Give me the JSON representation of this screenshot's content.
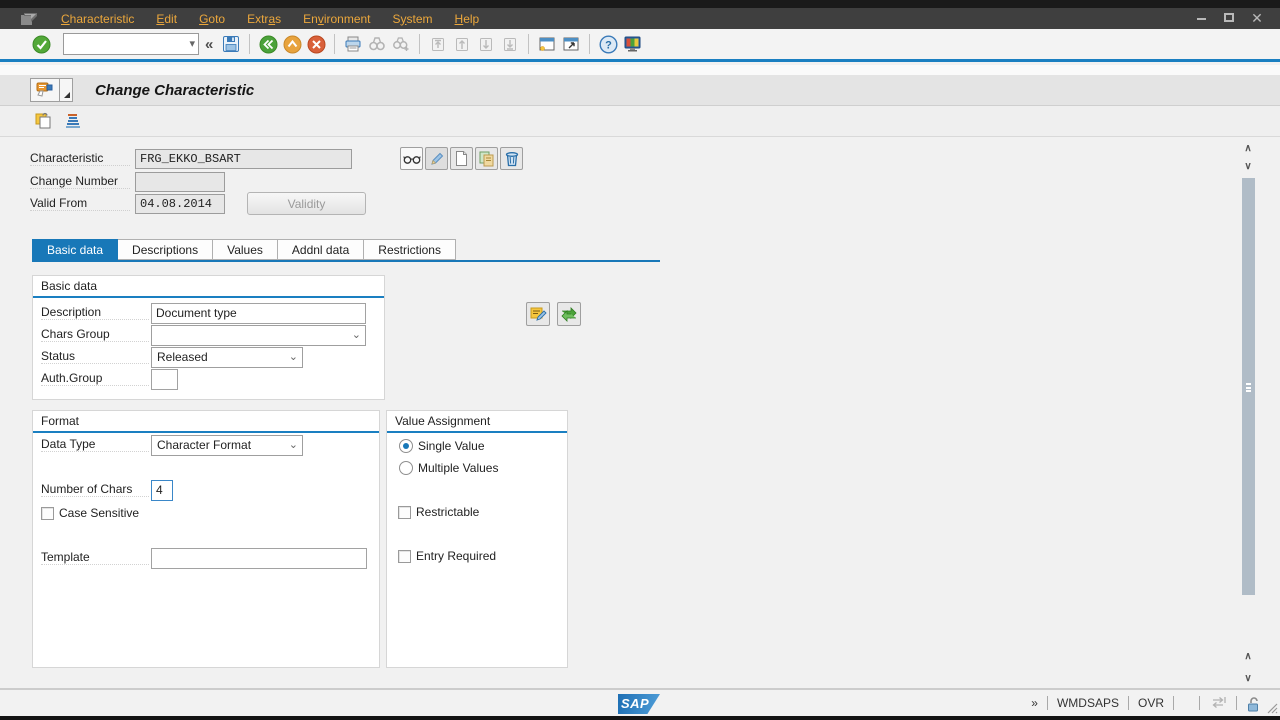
{
  "menubar": {
    "items": [
      {
        "label": "Characteristic",
        "accel": 0
      },
      {
        "label": "Edit",
        "accel": 0
      },
      {
        "label": "Goto",
        "accel": 0
      },
      {
        "label": "Extras",
        "accel": 4
      },
      {
        "label": "Environment",
        "accel": 2
      },
      {
        "label": "System",
        "accel": 1
      },
      {
        "label": "Help",
        "accel": 0
      }
    ]
  },
  "window_controls": {
    "minimize": "minimize",
    "maximize": "maximize",
    "close": "close"
  },
  "toolbar": {
    "command_value": "",
    "collapse_glyph": "«",
    "icons": [
      "enter-check-icon",
      "save-icon",
      "back-icon",
      "exit-icon",
      "cancel-icon",
      "print-icon",
      "find-icon",
      "find-next-icon",
      "first-page-icon",
      "previous-page-icon",
      "next-page-icon",
      "last-page-icon",
      "new-session-icon",
      "create-shortcut-icon",
      "help-icon",
      "customize-layout-icon"
    ]
  },
  "header": {
    "title": "Change Characteristic"
  },
  "app_toolbar": {
    "icons": [
      "clipboard-template-icon",
      "sort-hierarchy-icon"
    ]
  },
  "form": {
    "characteristic": {
      "label": "Characteristic",
      "value": "FRG_EKKO_BSART"
    },
    "change_number": {
      "label": "Change Number",
      "value": ""
    },
    "valid_from": {
      "label": "Valid From",
      "value": "04.08.2014"
    },
    "validity_button": "Validity",
    "action_icons": [
      "glasses-display-icon",
      "pencil-change-icon",
      "create-page-icon",
      "copy-icon",
      "trash-delete-icon"
    ]
  },
  "tabs": {
    "items": [
      "Basic data",
      "Descriptions",
      "Values",
      "Addnl data",
      "Restrictions"
    ],
    "active": "Basic data"
  },
  "basic_data": {
    "title": "Basic data",
    "description": {
      "label": "Description",
      "value": "Document type"
    },
    "chars_group": {
      "label": "Chars Group",
      "value": ""
    },
    "status": {
      "label": "Status",
      "value": "Released"
    },
    "auth_group": {
      "label": "Auth.Group",
      "value": ""
    },
    "side_icons": [
      "edit-note-icon",
      "exchange-arrows-icon"
    ]
  },
  "format": {
    "title": "Format",
    "data_type": {
      "label": "Data Type",
      "value": "Character Format"
    },
    "number_of_chars": {
      "label": "Number of Chars",
      "value": "4"
    },
    "case_sensitive": {
      "label": "Case Sensitive",
      "checked": false
    },
    "template": {
      "label": "Template",
      "value": ""
    }
  },
  "value_assignment": {
    "title": "Value Assignment",
    "single_value": {
      "label": "Single Value",
      "selected": true
    },
    "multiple_values": {
      "label": "Multiple Values",
      "selected": false
    },
    "restrictable": {
      "label": "Restrictable",
      "checked": false
    },
    "entry_required": {
      "label": "Entry Required",
      "checked": false
    }
  },
  "statusbar": {
    "logo": "SAP",
    "more_glyph": "»",
    "system": "WMDSAPS",
    "mode": "OVR",
    "icons": [
      "performance-arrows-icon",
      "unlocked-padlock-icon",
      "resize-grip"
    ]
  },
  "colors": {
    "accent_blue": "#1a7fc1",
    "tab_active": "#1878b8",
    "menu_text": "#eba73c",
    "menu_bg": "#3f3f3f",
    "status_green": "#52a838",
    "warn_orange": "#e8a33d",
    "error_red": "#d9534a"
  }
}
